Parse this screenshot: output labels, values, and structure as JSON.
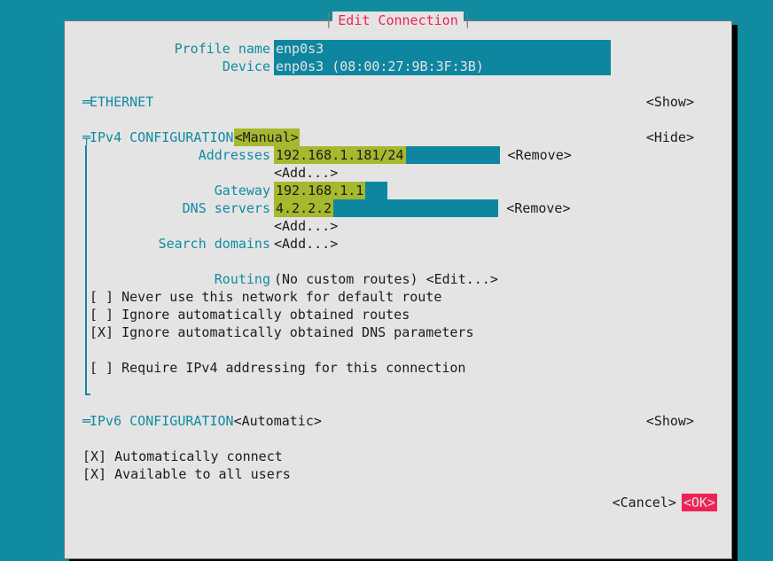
{
  "title": "Edit Connection",
  "profile": {
    "name_label": "Profile name",
    "name_value": "enp0s3",
    "device_label": "Device",
    "device_value": "enp0s3 (08:00:27:9B:3F:3B)"
  },
  "ethernet": {
    "title": "ETHERNET",
    "toggle": "<Show>"
  },
  "ipv4": {
    "title": "IPv4 CONFIGURATION",
    "mode": "<Manual>",
    "toggle": "<Hide>",
    "addresses_label": "Addresses",
    "address_value": "192.168.1.181/24",
    "remove": "<Remove>",
    "add": "<Add...>",
    "gateway_label": "Gateway",
    "gateway_value": "192.168.1.1",
    "dns_label": "DNS servers",
    "dns_value": "4.2.2.2",
    "search_label": "Search domains",
    "routing_label": "Routing",
    "routing_value": "(No custom routes)",
    "edit": "<Edit...>",
    "cb1": "[ ] Never use this network for default route",
    "cb2": "[ ] Ignore automatically obtained routes",
    "cb3": "[X] Ignore automatically obtained DNS parameters",
    "cb4": "[ ] Require IPv4 addressing for this connection"
  },
  "ipv6": {
    "title": "IPv6 CONFIGURATION",
    "mode": "<Automatic>",
    "toggle": "<Show>"
  },
  "global": {
    "auto_connect": "[X] Automatically connect",
    "all_users": "[X] Available to all users"
  },
  "buttons": {
    "cancel": "<Cancel>",
    "ok": "<OK>"
  }
}
